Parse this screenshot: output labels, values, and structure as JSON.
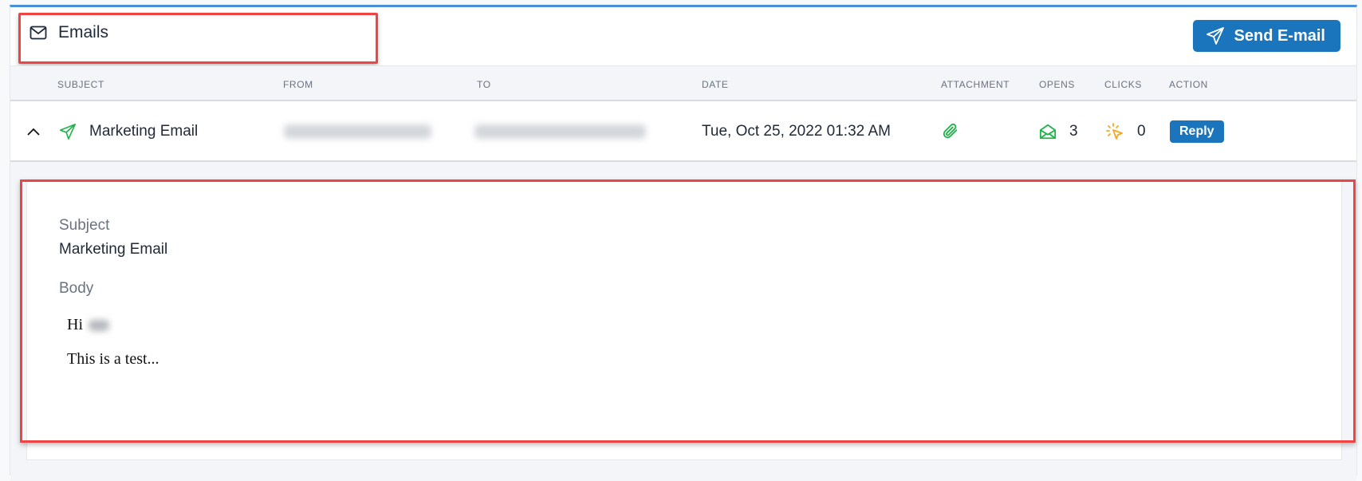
{
  "header": {
    "title": "Emails",
    "title_icon": "mail-icon",
    "send_button": {
      "label": "Send E-mail",
      "icon": "send-icon"
    }
  },
  "table": {
    "columns": [
      "SUBJECT",
      "FROM",
      "TO",
      "DATE",
      "ATTACHMENT",
      "OPENS",
      "CLICKS",
      "ACTION"
    ],
    "rows": [
      {
        "expanded": true,
        "subject": "Marketing Email",
        "from": "[redacted]",
        "to": "[redacted]",
        "date": "Tue, Oct 25, 2022 01:32 AM",
        "has_attachment": true,
        "opens": "3",
        "clicks": "0",
        "action_label": "Reply"
      }
    ]
  },
  "detail": {
    "subject_label": "Subject",
    "subject_value": "Marketing Email",
    "body_label": "Body",
    "body_greeting": "Hi",
    "body_text": "This is a test..."
  },
  "colors": {
    "primary": "#1b75bc",
    "accent_top": "#4a90d9",
    "success": "#22b24c",
    "warning": "#f5a623",
    "highlight": "#ef4444"
  }
}
